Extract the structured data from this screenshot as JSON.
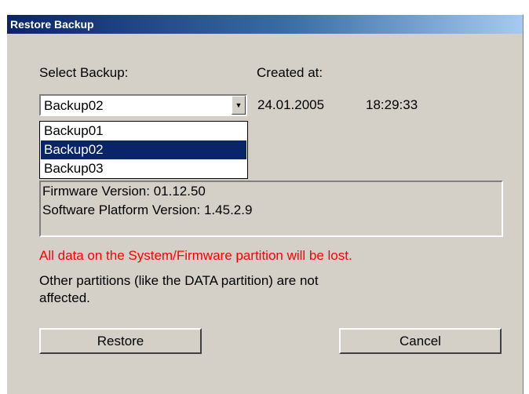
{
  "window": {
    "title": "Restore Backup"
  },
  "labels": {
    "select_backup": "Select Backup:",
    "created_at": "Created at:"
  },
  "backup_select": {
    "value": "Backup02",
    "options": [
      "Backup01",
      "Backup02",
      "Backup03"
    ],
    "selected_option": "Backup02"
  },
  "created": {
    "date": "24.01.2005",
    "time": "18:29:33"
  },
  "info": {
    "firmware": "Firmware Version: 01.12.50",
    "platform": "Software Platform Version: 1.45.2.9"
  },
  "messages": {
    "warning": "All data on the System/Firmware partition will be lost.",
    "note_line1": "Other partitions (like the DATA partition) are not",
    "note_line2": "affected."
  },
  "buttons": {
    "restore": "Restore",
    "cancel": "Cancel"
  },
  "colors": {
    "warning": "#ff0000",
    "selection": "#0a246a",
    "titlebar": "#0a246a"
  }
}
